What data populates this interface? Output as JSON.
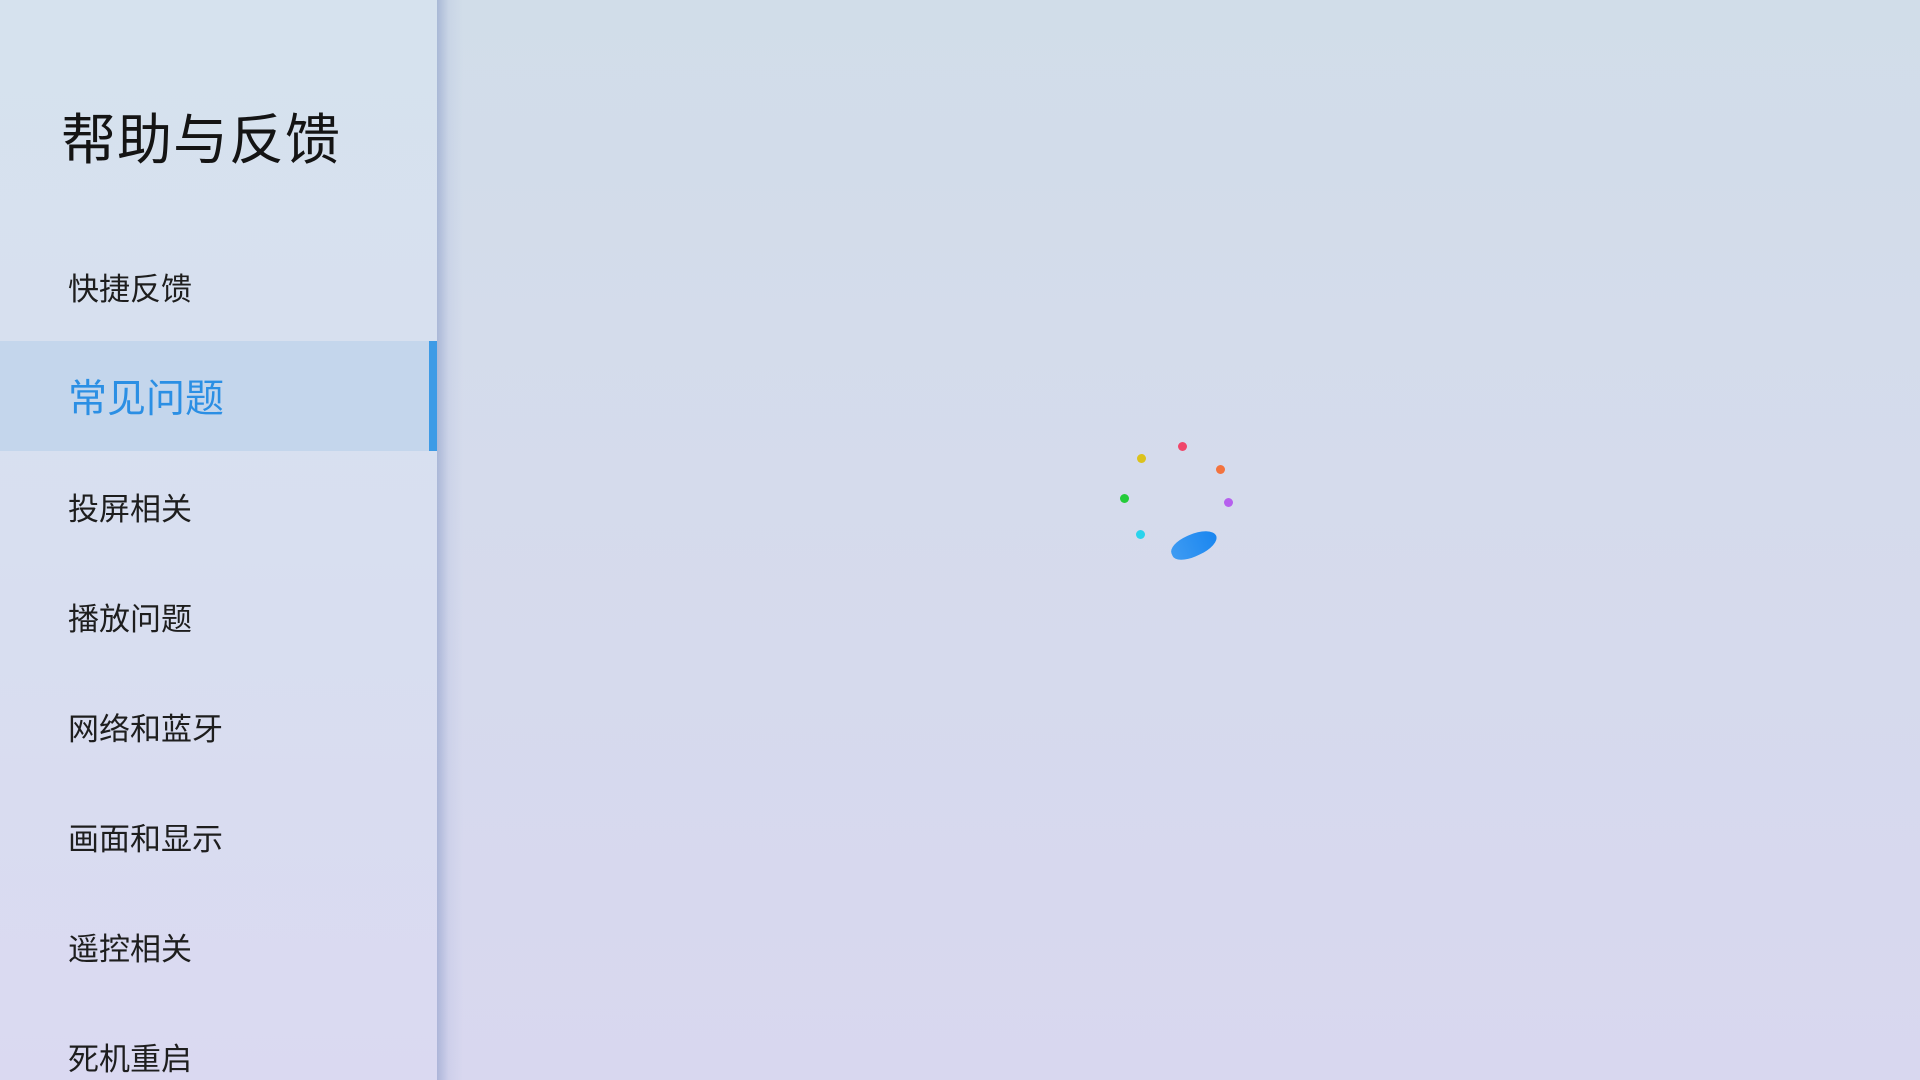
{
  "sidebar": {
    "title": "帮助与反馈",
    "items": [
      {
        "label": "快捷反馈",
        "active": false
      },
      {
        "label": "常见问题",
        "active": true
      },
      {
        "label": "投屏相关",
        "active": false
      },
      {
        "label": "播放问题",
        "active": false
      },
      {
        "label": "网络和蓝牙",
        "active": false
      },
      {
        "label": "画面和显示",
        "active": false
      },
      {
        "label": "遥控相关",
        "active": false
      },
      {
        "label": "死机重启",
        "active": false
      }
    ]
  },
  "main": {
    "loading_icon": "loading-spinner-icon",
    "spinner_colors": [
      "#f0466a",
      "#f3733e",
      "#b660ee",
      "#dcc21c",
      "#24cc3a",
      "#2ad3ec",
      "#1a86f0"
    ]
  },
  "colors": {
    "accent": "#2b8fe4",
    "active_bar": "#3d9be6",
    "active_background": "#c4d6ec"
  }
}
